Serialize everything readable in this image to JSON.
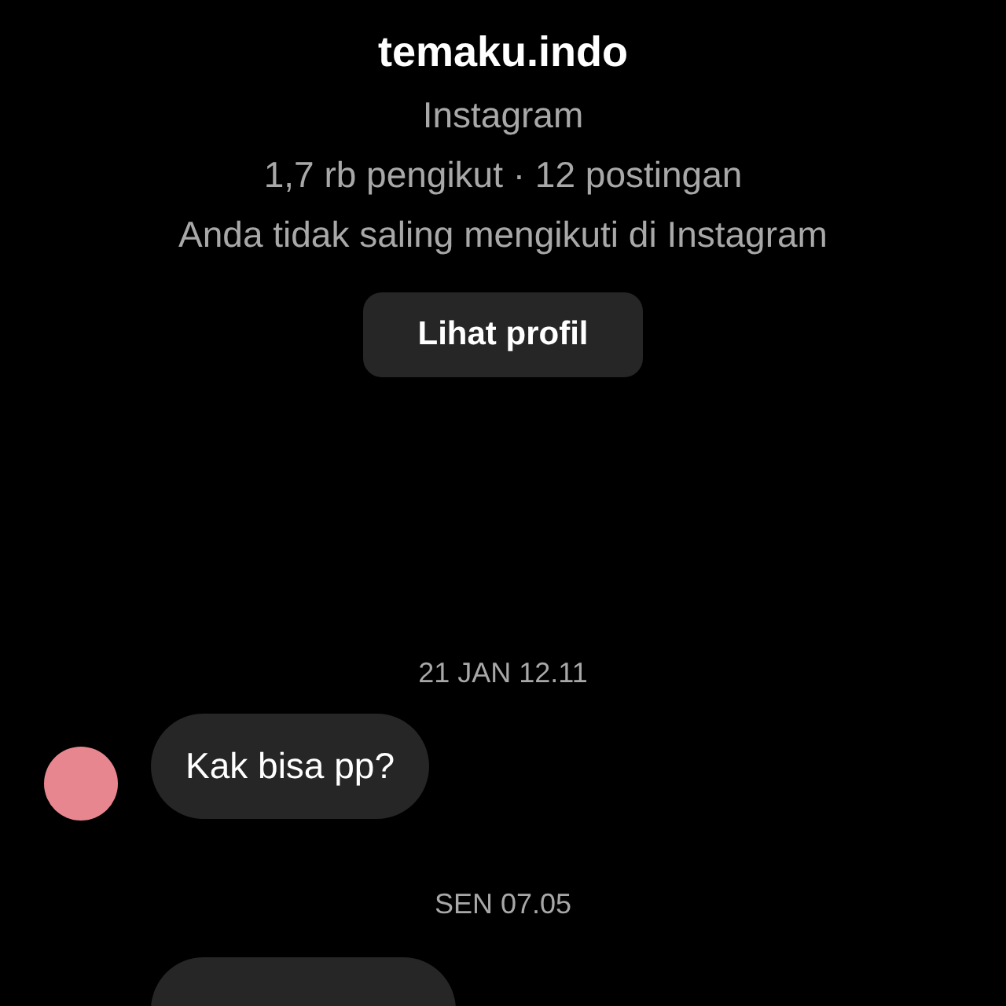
{
  "profile": {
    "username": "temaku.indo",
    "platform": "Instagram",
    "stats": "1,7 rb pengikut · 12 postingan",
    "follow_note": "Anda tidak saling mengikuti di Instagram",
    "button": "Lihat profil"
  },
  "thread": [
    {
      "kind": "timestamp",
      "text": "21 JAN 12.11"
    },
    {
      "kind": "message",
      "text": "Kak bisa pp?",
      "color": "#e8868f"
    },
    {
      "kind": "timestamp",
      "text": "SEN 07.05"
    },
    {
      "kind": "cut_message"
    }
  ]
}
